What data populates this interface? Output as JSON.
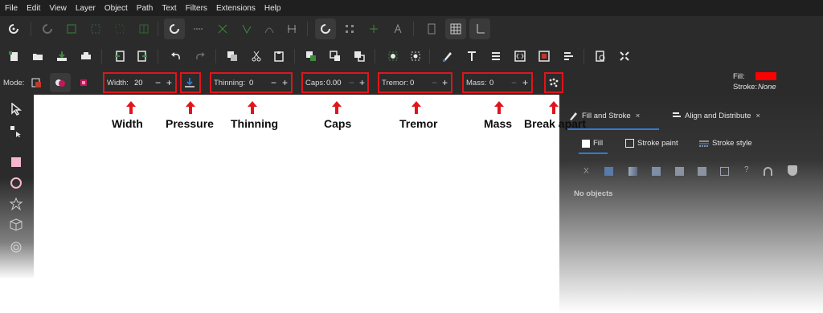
{
  "menu": [
    "File",
    "Edit",
    "View",
    "Layer",
    "Object",
    "Path",
    "Text",
    "Filters",
    "Extensions",
    "Help"
  ],
  "tool_controls": {
    "mode_label": "Mode:",
    "width": {
      "label": "Width:",
      "value": "20"
    },
    "thinning": {
      "label": "Thinning:",
      "value": "0"
    },
    "caps": {
      "label": "Caps:",
      "value": "0.00"
    },
    "tremor": {
      "label": "Tremor:",
      "value": "0"
    },
    "mass": {
      "label": "Mass:",
      "value": "0"
    },
    "minus": "−",
    "plus": "+"
  },
  "style_indicator": {
    "fill_label": "Fill:",
    "fill_color": "#ff0000",
    "stroke_label": "Stroke:",
    "stroke_value": "None"
  },
  "annotations": {
    "width": "Width",
    "pressure": "Pressure",
    "thinning": "Thinning",
    "caps": "Caps",
    "tremor": "Tremor",
    "mass": "Mass",
    "break_apart": "Break apart"
  },
  "dock": {
    "tabs": [
      "Fill and Stroke",
      "Align and Distribute"
    ],
    "close_glyph": "×",
    "subtabs": [
      "Fill",
      "Stroke paint",
      "Stroke style"
    ],
    "paint_type_unset": "X",
    "paint_type_unknown": "?",
    "status": "No objects"
  },
  "colors": {
    "highlight": "#e1141b",
    "dark_bg": "#2b2b2b",
    "accent_blue": "#2f7bd6"
  }
}
